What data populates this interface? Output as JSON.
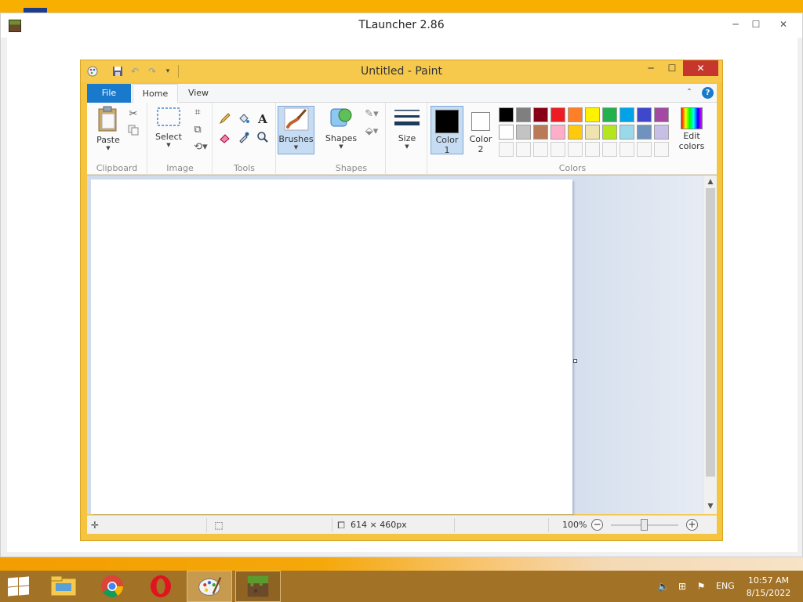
{
  "tlauncher": {
    "title": "TLauncher 2.86",
    "controls": {
      "minimize": "─",
      "maximize": "☐",
      "close": "✕"
    }
  },
  "paint": {
    "title": "Untitled - Paint",
    "qat_icons": [
      "paint-app-icon",
      "save-icon",
      "undo-icon",
      "redo-icon",
      "customize-qat-icon"
    ],
    "window_controls": {
      "minimize": "─",
      "maximize": "☐",
      "close": "✕"
    },
    "tabs": {
      "file": "File",
      "home": "Home",
      "view": "View"
    },
    "help": "?",
    "groups": {
      "clipboard": {
        "label": "Clipboard",
        "paste": "Paste"
      },
      "image": {
        "label": "Image",
        "select": "Select"
      },
      "tools": {
        "label": "Tools"
      },
      "brushes": {
        "label": "Brushes"
      },
      "shapes": {
        "label": "Shapes",
        "shapes_btn": "Shapes"
      },
      "size": {
        "label": "Size"
      },
      "colors": {
        "label": "Colors",
        "color1_line1": "Color",
        "color1_line2": "1",
        "color2_line1": "Color",
        "color2_line2": "2",
        "edit_line1": "Edit",
        "edit_line2": "colors",
        "color1_value": "#000000",
        "color2_value": "#ffffff",
        "palette_row1": [
          "#000000",
          "#7f7f7f",
          "#880015",
          "#ed1c24",
          "#ff7f27",
          "#fff200",
          "#22b14c",
          "#00a2e8",
          "#3f48cc",
          "#a349a4"
        ],
        "palette_row2": [
          "#ffffff",
          "#c3c3c3",
          "#b97a57",
          "#ffaec9",
          "#ffc90e",
          "#efe4b0",
          "#b5e61d",
          "#99d9ea",
          "#7092be",
          "#c8bfe7"
        ]
      }
    },
    "statusbar": {
      "image_size": "614 × 460px",
      "zoom": "100%"
    }
  },
  "taskbar": {
    "apps": [
      "file-explorer-icon",
      "chrome-icon",
      "opera-icon",
      "paint-icon",
      "minecraft-icon"
    ],
    "language": "ENG",
    "time": "10:57 AM",
    "date": "8/15/2022"
  }
}
